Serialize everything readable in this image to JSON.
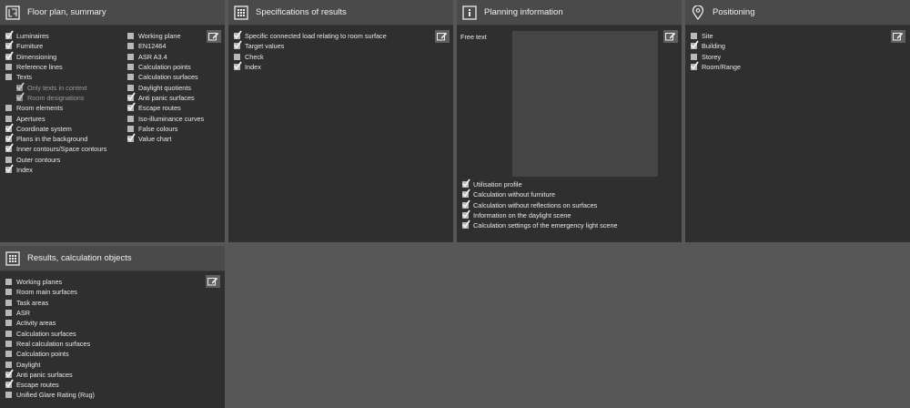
{
  "floor_plan": {
    "title": "Floor plan, summary",
    "left": [
      {
        "label": "Luminaires",
        "checked": true,
        "indent": 0,
        "disabled": false
      },
      {
        "label": "Furniture",
        "checked": true,
        "indent": 0,
        "disabled": false
      },
      {
        "label": "Dimensioning",
        "checked": true,
        "indent": 0,
        "disabled": false
      },
      {
        "label": "Reference lines",
        "checked": false,
        "indent": 0,
        "disabled": false
      },
      {
        "label": "Texts",
        "checked": false,
        "indent": 0,
        "disabled": false
      },
      {
        "label": "Only texts in context",
        "checked": true,
        "indent": 1,
        "disabled": true
      },
      {
        "label": "Room designations",
        "checked": true,
        "indent": 1,
        "disabled": true
      },
      {
        "label": "Room elements",
        "checked": false,
        "indent": 0,
        "disabled": false
      },
      {
        "label": "Apertures",
        "checked": false,
        "indent": 0,
        "disabled": false
      },
      {
        "label": "Coordinate system",
        "checked": true,
        "indent": 0,
        "disabled": false
      },
      {
        "label": "Plans in the background",
        "checked": true,
        "indent": 0,
        "disabled": false
      },
      {
        "label": "Inner contours/Space contours",
        "checked": true,
        "indent": 0,
        "disabled": false
      },
      {
        "label": "Outer contours",
        "checked": false,
        "indent": 0,
        "disabled": false
      },
      {
        "label": "Index",
        "checked": true,
        "indent": 0,
        "disabled": false
      }
    ],
    "right": [
      {
        "label": "Working plane",
        "checked": false
      },
      {
        "label": "EN12464",
        "checked": false
      },
      {
        "label": "ASR A3.4",
        "checked": false
      },
      {
        "label": "Calculation points",
        "checked": false
      },
      {
        "label": "Calculation surfaces",
        "checked": false
      },
      {
        "label": "Daylight quotients",
        "checked": false
      },
      {
        "label": "Anti panic surfaces",
        "checked": true
      },
      {
        "label": "Escape routes",
        "checked": true
      },
      {
        "label": "Iso-illuminance curves",
        "checked": false
      },
      {
        "label": "False colours",
        "checked": false
      },
      {
        "label": "Value chart",
        "checked": true
      }
    ]
  },
  "specs": {
    "title": "Specifications of results",
    "items": [
      {
        "label": "Specific connected load relating to room surface",
        "checked": true
      },
      {
        "label": "Target values",
        "checked": true
      },
      {
        "label": "Check",
        "checked": false
      },
      {
        "label": "Index",
        "checked": true
      }
    ]
  },
  "planning": {
    "title": "Planning information",
    "free_text_label": "Free text",
    "items": [
      {
        "label": "Utilisation profile",
        "checked": true
      },
      {
        "label": "Calculation without furniture",
        "checked": true
      },
      {
        "label": "Calculation without reflections on surfaces",
        "checked": true
      },
      {
        "label": "Information on the daylight scene",
        "checked": true
      },
      {
        "label": "Calculation settings of the emergency light scene",
        "checked": true
      }
    ]
  },
  "positioning": {
    "title": "Positioning",
    "items": [
      {
        "label": "Site",
        "checked": false
      },
      {
        "label": "Building",
        "checked": true
      },
      {
        "label": "Storey",
        "checked": false
      },
      {
        "label": "Room/Range",
        "checked": true
      }
    ]
  },
  "results": {
    "title": "Results, calculation objects",
    "items": [
      {
        "label": "Working planes",
        "checked": false
      },
      {
        "label": "Room main surfaces",
        "checked": false
      },
      {
        "label": "Task areas",
        "checked": false
      },
      {
        "label": "ASR",
        "checked": false
      },
      {
        "label": "Activity areas",
        "checked": false
      },
      {
        "label": "Calculation surfaces",
        "checked": false
      },
      {
        "label": "Real calculation surfaces",
        "checked": false
      },
      {
        "label": "Calculation points",
        "checked": false
      },
      {
        "label": "Daylight",
        "checked": false
      },
      {
        "label": "Anti panic surfaces",
        "checked": true
      },
      {
        "label": "Escape routes",
        "checked": true
      },
      {
        "label": "Unified Glare Rating (Rug)",
        "checked": false
      }
    ]
  }
}
